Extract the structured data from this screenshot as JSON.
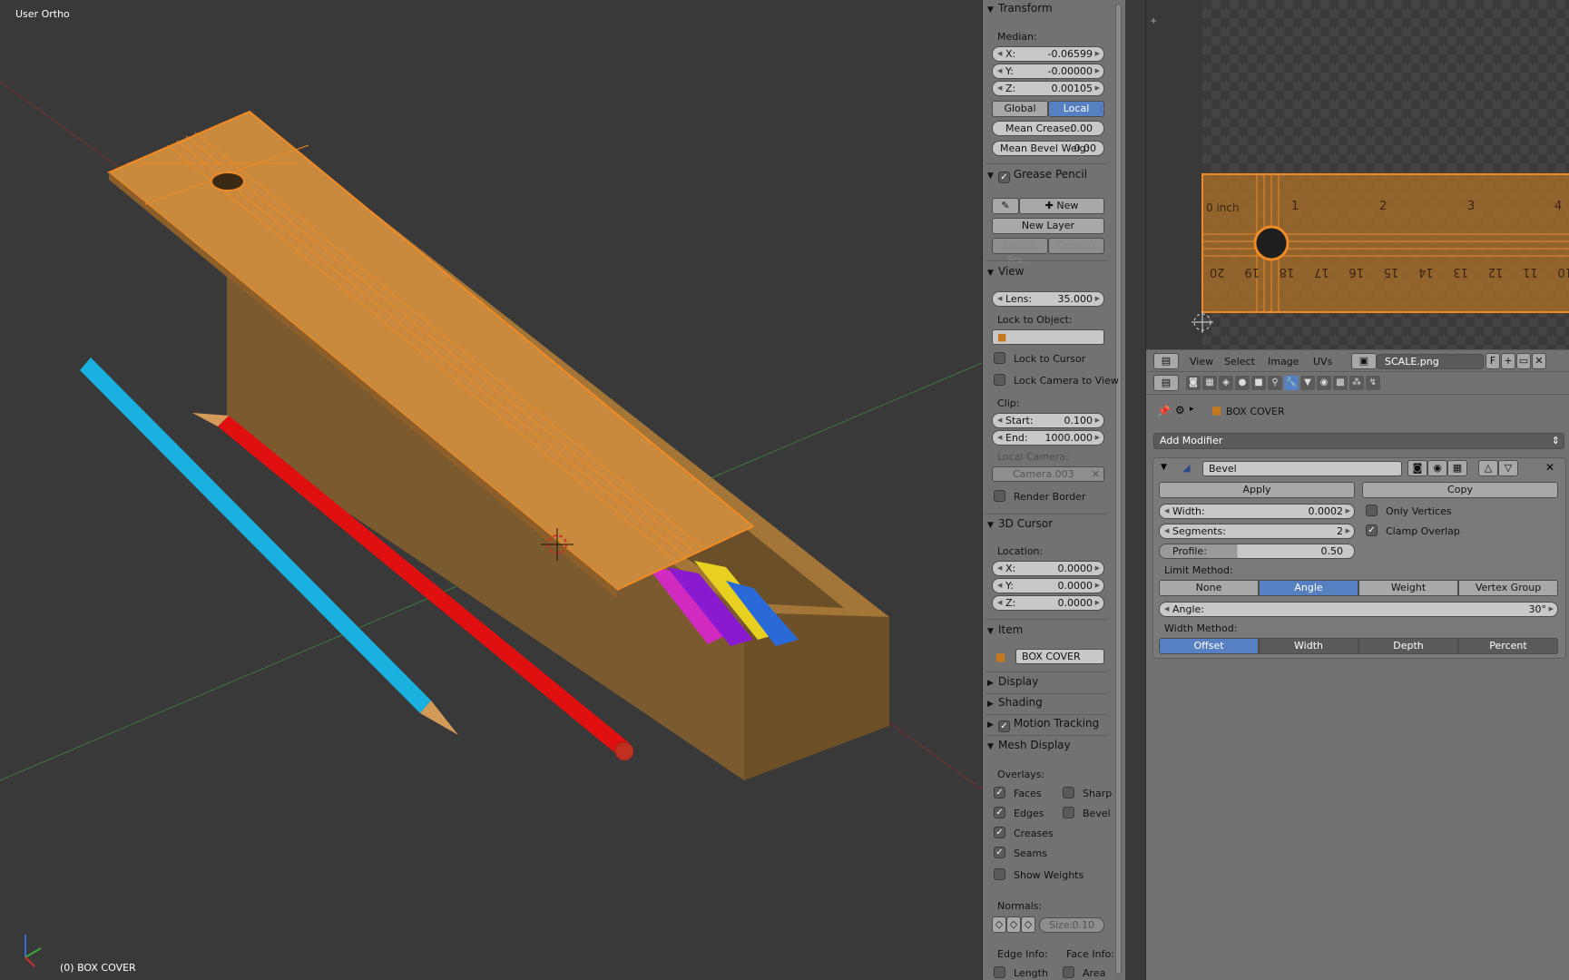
{
  "viewport": {
    "label": "User Ortho",
    "object_label": "(0) BOX COVER"
  },
  "transform": {
    "title": "Transform",
    "median_label": "Median:",
    "x": {
      "label": "X:",
      "value": "-0.06599"
    },
    "y": {
      "label": "Y:",
      "value": "-0.00000"
    },
    "z": {
      "label": "Z:",
      "value": "0.00105"
    },
    "global": "Global",
    "local": "Local",
    "mean_crease": {
      "label": "Mean Crease:",
      "value": "0.00"
    },
    "mean_bevel": {
      "label": "Mean Bevel Weig:",
      "value": "0.00"
    }
  },
  "grease": {
    "title": "Grease Pencil",
    "new": "New",
    "new_layer": "New Layer",
    "delete_frame": "Delete Fra...",
    "convert": "Convert"
  },
  "view": {
    "title": "View",
    "lens": {
      "label": "Lens:",
      "value": "35.000"
    },
    "lock_to_object": "Lock to Object:",
    "lock_to_cursor": "Lock to Cursor",
    "lock_camera": "Lock Camera to View",
    "clip": "Clip:",
    "start": {
      "label": "Start:",
      "value": "0.100"
    },
    "end": {
      "label": "End:",
      "value": "1000.000"
    },
    "local_camera": "Local Camera:",
    "camera_value": "Camera.003",
    "render_border": "Render Border"
  },
  "cursor": {
    "title": "3D Cursor",
    "location": "Location:",
    "x": {
      "label": "X:",
      "value": "0.0000"
    },
    "y": {
      "label": "Y:",
      "value": "0.0000"
    },
    "z": {
      "label": "Z:",
      "value": "0.0000"
    }
  },
  "item": {
    "title": "Item",
    "name": "BOX COVER"
  },
  "panels": {
    "display": "Display",
    "shading": "Shading",
    "motion_tracking": "Motion Tracking",
    "mesh_display": "Mesh Display"
  },
  "mesh_display": {
    "overlays": "Overlays:",
    "faces": "Faces",
    "sharp": "Sharp",
    "edges": "Edges",
    "bevel": "Bevel",
    "creases": "Creases",
    "seams": "Seams",
    "show_weights": "Show Weights",
    "normals": "Normals:",
    "size": {
      "label": "Size:",
      "value": "0.10"
    },
    "edge_info": "Edge Info:",
    "face_info": "Face Info:",
    "length": "Length",
    "area": "Area"
  },
  "uv_header": {
    "view": "View",
    "select": "Select",
    "image": "Image",
    "uvs": "UVs",
    "image_name": "SCALE.png",
    "f": "F"
  },
  "ruler": {
    "top_labels": [
      "0 inch",
      "1",
      "2",
      "3",
      "4"
    ],
    "bottom_labels": [
      "20",
      "19",
      "18",
      "17",
      "16",
      "15",
      "14",
      "13",
      "12",
      "11",
      "10"
    ]
  },
  "properties": {
    "breadcrumb": "BOX COVER",
    "add_modifier": "Add Modifier",
    "modifier_name": "Bevel",
    "apply": "Apply",
    "copy": "Copy",
    "width": {
      "label": "Width:",
      "value": "0.0002"
    },
    "segments": {
      "label": "Segments:",
      "value": "2"
    },
    "profile": {
      "label": "Profile:",
      "value": "0.50"
    },
    "only_vertices": "Only Vertices",
    "clamp_overlap": "Clamp Overlap",
    "limit_method": "Limit Method:",
    "limit_opts": [
      "None",
      "Angle",
      "Weight",
      "Vertex Group"
    ],
    "angle": {
      "label": "Angle:",
      "value": "30°"
    },
    "width_method": "Width Method:",
    "width_opts": [
      "Offset",
      "Width",
      "Depth",
      "Percent"
    ]
  },
  "colors": {
    "accent": "#5680c2",
    "wood": "#b5813f",
    "orange_select": "#f08a24"
  }
}
